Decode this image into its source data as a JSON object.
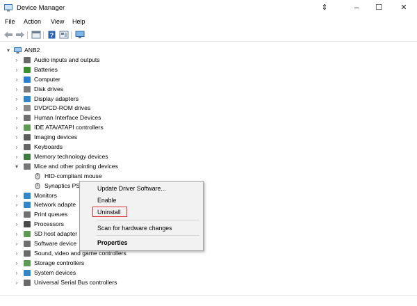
{
  "window": {
    "title": "Device Manager",
    "controls": {
      "restore": "⇕",
      "minimize": "–",
      "maximize": "☐",
      "close": "✕"
    }
  },
  "menu": [
    "File",
    "Action",
    "View",
    "Help"
  ],
  "toolbar": [
    "back-arrow-icon",
    "forward-arrow-icon",
    "properties-icon",
    "help-icon",
    "view-icon",
    "monitor-icon"
  ],
  "tree": {
    "root": "ANB2",
    "items": [
      {
        "label": "Audio inputs and outputs",
        "icon": "speaker-icon",
        "color": "#6a6a6a"
      },
      {
        "label": "Batteries",
        "icon": "battery-icon",
        "color": "#3b8f2e"
      },
      {
        "label": "Computer",
        "icon": "computer-icon",
        "color": "#2c7fd0"
      },
      {
        "label": "Disk drives",
        "icon": "disk-icon",
        "color": "#7a7a7a"
      },
      {
        "label": "Display adapters",
        "icon": "display-icon",
        "color": "#2f86c8"
      },
      {
        "label": "DVD/CD-ROM drives",
        "icon": "dvd-icon",
        "color": "#8a8a8a"
      },
      {
        "label": "Human Interface Devices",
        "icon": "hid-icon",
        "color": "#6f6f6f"
      },
      {
        "label": "IDE ATA/ATAPI controllers",
        "icon": "ide-icon",
        "color": "#5b9b52"
      },
      {
        "label": "Imaging devices",
        "icon": "camera-icon",
        "color": "#5c5c5c"
      },
      {
        "label": "Keyboards",
        "icon": "keyboard-icon",
        "color": "#666666"
      },
      {
        "label": "Memory technology devices",
        "icon": "memory-icon",
        "color": "#3d7a3d"
      },
      {
        "label": "Mice and other pointing devices",
        "icon": "mouse-icon",
        "color": "#777777",
        "expanded": true,
        "children": [
          {
            "label": "HID-compliant mouse",
            "icon": "mouse-icon",
            "color": "#777777"
          },
          {
            "label": "Synaptics PS",
            "icon": "mouse-icon",
            "color": "#777777"
          }
        ]
      },
      {
        "label": "Monitors",
        "icon": "monitor-icon",
        "color": "#2f86c8"
      },
      {
        "label": "Network adapte",
        "icon": "network-icon",
        "color": "#2f86c8"
      },
      {
        "label": "Print queues",
        "icon": "printer-icon",
        "color": "#707070"
      },
      {
        "label": "Processors",
        "icon": "processor-icon",
        "color": "#4a4a4a"
      },
      {
        "label": "SD host adapter",
        "icon": "sd-icon",
        "color": "#5b9b52"
      },
      {
        "label": "Software device",
        "icon": "software-icon",
        "color": "#6f6f6f"
      },
      {
        "label": "Sound, video and game controllers",
        "icon": "sound-icon",
        "color": "#6a6a6a"
      },
      {
        "label": "Storage controllers",
        "icon": "storage-icon",
        "color": "#5b9b52"
      },
      {
        "label": "System devices",
        "icon": "system-icon",
        "color": "#2f86c8"
      },
      {
        "label": "Universal Serial Bus controllers",
        "icon": "usb-icon",
        "color": "#6a6a6a"
      }
    ]
  },
  "context_menu": {
    "items": [
      "Update Driver Software...",
      "Enable",
      "Uninstall",
      "Scan for hardware changes",
      "Properties"
    ]
  }
}
